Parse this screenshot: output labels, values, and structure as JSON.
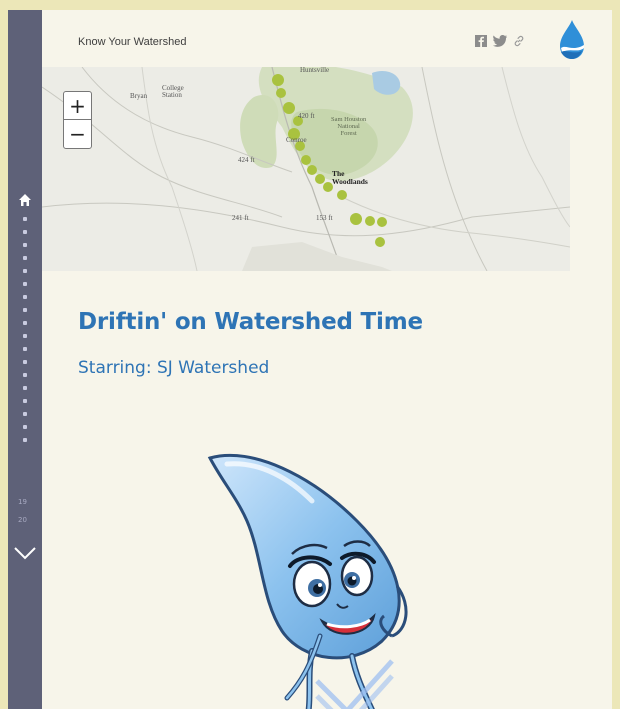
{
  "header": {
    "title": "Know Your Watershed",
    "share_icons": [
      "facebook-icon",
      "twitter-icon",
      "link-icon"
    ],
    "logo_icon": "water-drop-logo"
  },
  "sidenav": {
    "home_icon": "home-icon",
    "section_count": 20,
    "visible_numbers": [
      "19",
      "20"
    ],
    "down_icon": "chevron-down-icon"
  },
  "map": {
    "zoom_in_label": "+",
    "zoom_out_label": "−",
    "labels": {
      "bryan": "Bryan",
      "college_station": "College\nStation",
      "top": "Huntsville",
      "sam_houston": "Sam Houston\nNational\nForest",
      "woodlands": "The\nWoodlands",
      "conroe": "Conroe",
      "e420": "420 ft",
      "e424": "424 ft",
      "e241": "241 ft",
      "e153": "153 ft"
    }
  },
  "story": {
    "title": "Driftin' on Watershed Time",
    "subtitle": "Starring: SJ Watershed"
  },
  "colors": {
    "page_bg": "#ece7b8",
    "panel_bg": "#f7f5ea",
    "nav_bg": "#5e6178",
    "title_blue": "#2e74b5",
    "route_dot": "#a9c23f"
  }
}
